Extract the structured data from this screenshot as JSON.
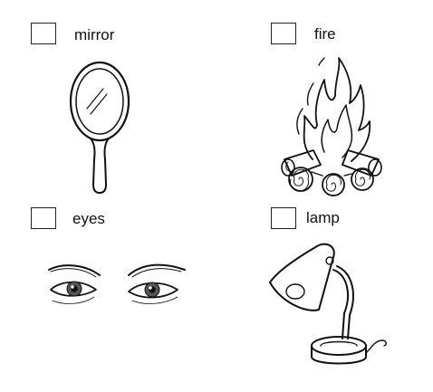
{
  "items": [
    {
      "label": "mirror",
      "icon": "hand-mirror",
      "checked": false
    },
    {
      "label": "fire",
      "icon": "campfire",
      "checked": false
    },
    {
      "label": "eyes",
      "icon": "eyes",
      "checked": false
    },
    {
      "label": "lamp",
      "icon": "desk-lamp",
      "checked": false
    }
  ]
}
